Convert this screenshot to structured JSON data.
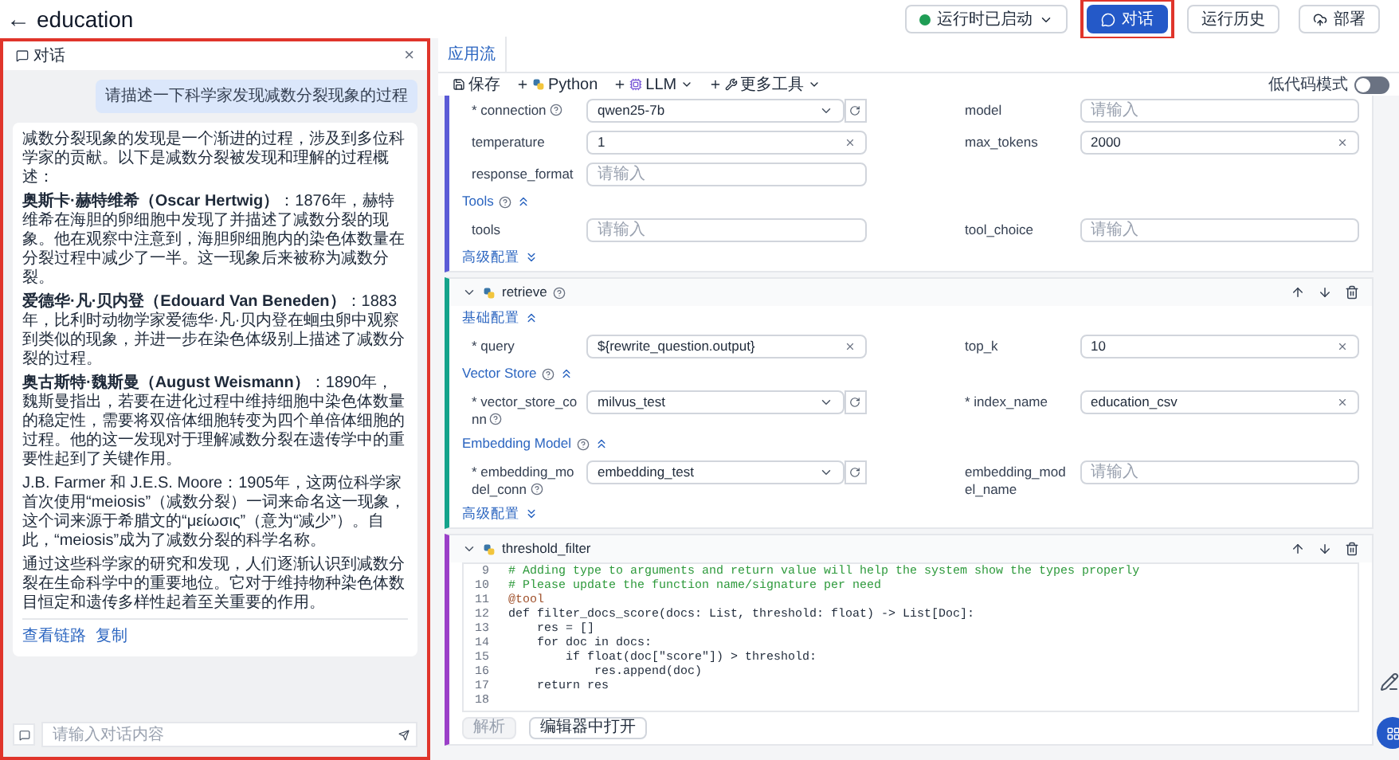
{
  "page": {
    "title": "education",
    "back": "←"
  },
  "header_actions": [
    {
      "kind": "status",
      "label": "运行时已启动",
      "highlighted": false
    },
    {
      "kind": "primary",
      "label": "对话",
      "highlighted": true
    },
    {
      "kind": "plain",
      "label": "运行历史",
      "highlighted": false
    },
    {
      "kind": "deploy",
      "label": "部署",
      "highlighted": false
    }
  ],
  "chat": {
    "title": "对话",
    "close": "×",
    "highlighted": true,
    "messages": [
      {
        "kind": "user",
        "paragraphs": [
          "请描述一下科学家发现减数分裂现象的过程"
        ]
      },
      {
        "kind": "assistant",
        "paragraphs": [
          "减数分裂现象的发现是一个渐进的过程，涉及到多位科学家的贡献。以下是减数分裂被发现和理解的过程概述：",
          "**奥斯卡·赫特维希（Oscar Hertwig）**：1876年，赫特维希在海胆的卵细胞中发现了并描述了减数分裂的现象。他在观察中注意到，海胆卵细胞内的染色体数量在分裂过程中减少了一半。这一现象后来被称为减数分裂。",
          "**爱德华·凡·贝内登（Edouard Van Beneden）**：1883年，比利时动物学家爱德华·凡·贝内登在蛔虫卵中观察到类似的现象，并进一步在染色体级别上描述了减数分裂的过程。",
          "**奥古斯特·魏斯曼（August Weismann）**：1890年，魏斯曼指出，若要在进化过程中维持细胞中染色体数量的稳定性，需要将双倍体细胞转变为四个单倍体细胞的过程。他的这一发现对于理解减数分裂在遗传学中的重要性起到了关键作用。",
          "J.B. Farmer 和 J.E.S. Moore：1905年，这两位科学家首次使用“meiosis”（减数分裂）一词来命名这一现象，这个词来源于希腊文的“μείωσις”（意为“减少”）。自此，“meiosis”成为了减数分裂的科学名称。",
          "通过这些科学家的研究和发现，人们逐渐认识到减数分裂在生命科学中的重要地位。它对于维持物种染色体数目恒定和遗传多样性起着至关重要的作用。"
        ],
        "links": [
          "查看链路",
          "复制"
        ]
      }
    ],
    "input": {
      "placeholder": "请输入对话内容"
    }
  },
  "workspace": {
    "tabs": [
      {
        "label": "应用流",
        "selected": true
      }
    ],
    "toolbar": [
      {
        "kind": "save",
        "label": "保存"
      },
      {
        "kind": "python",
        "label": "Python"
      },
      {
        "kind": "llm",
        "label": "LLM"
      },
      {
        "kind": "tools",
        "label": "更多工具"
      }
    ],
    "low_code": {
      "label": "低代码模式",
      "on": false
    },
    "nodes": [
      {
        "kind": "form",
        "color": "#5b5bd6",
        "sections": [
          {
            "rows": [
              [
                {
                  "label": "* connection",
                  "help": true,
                  "kind": "select",
                  "value": "qwen25-7b"
                },
                {
                  "label": "model",
                  "help": false,
                  "kind": "input",
                  "placeholder": "请输入"
                }
              ],
              [
                {
                  "label": "temperature",
                  "help": false,
                  "kind": "input",
                  "value": "1",
                  "clearable": true
                },
                {
                  "label": "max_tokens",
                  "help": false,
                  "kind": "input",
                  "value": "2000",
                  "clearable": true
                }
              ],
              [
                {
                  "label": "response_format",
                  "help": false,
                  "kind": "input",
                  "placeholder": "请输入",
                  "clearable": false
                }
              ]
            ]
          },
          {
            "title": "Tools",
            "help": true,
            "expanded": true,
            "rows": [
              [
                {
                  "label": "tools",
                  "help": false,
                  "kind": "input",
                  "placeholder": "请输入",
                  "clearable": false
                },
                {
                  "label": "tool_choice",
                  "help": false,
                  "kind": "input",
                  "placeholder": "请输入",
                  "clearable": false
                }
              ]
            ]
          },
          {
            "title": "高级配置",
            "help": false,
            "expanded": false
          }
        ]
      },
      {
        "kind": "form",
        "title": "retrieve",
        "help": true,
        "color": "#14a38b",
        "sections": [
          {
            "title": "基础配置",
            "help": false,
            "expanded": true,
            "rows": [
              [
                {
                  "label": "* query",
                  "help": false,
                  "kind": "input",
                  "value": "${rewrite_question.output}",
                  "clearable": true
                },
                {
                  "label": "top_k",
                  "help": false,
                  "kind": "input",
                  "value": "10",
                  "clearable": true
                }
              ]
            ]
          },
          {
            "title": "Vector Store",
            "help": true,
            "expanded": true,
            "rows": [
              [
                {
                  "label": "* vector_store_conn",
                  "help": true,
                  "kind": "select",
                  "value": "milvus_test"
                },
                {
                  "label": "* index_name",
                  "help": false,
                  "kind": "input",
                  "value": "education_csv",
                  "clearable": true
                }
              ]
            ]
          },
          {
            "title": "Embedding Model",
            "help": true,
            "expanded": true,
            "rows": [
              [
                {
                  "label": "* embedding_model_conn",
                  "help": true,
                  "kind": "select",
                  "value": "embedding_test"
                },
                {
                  "label": "embedding_model_name",
                  "help": false,
                  "kind": "input",
                  "placeholder": "请输入",
                  "clearable": false
                }
              ]
            ]
          },
          {
            "title": "高级配置",
            "help": false,
            "expanded": false
          }
        ]
      },
      {
        "kind": "code",
        "title": "threshold_filter",
        "help": false,
        "color": "#9b3fc8",
        "lines": [
          {
            "no": "9",
            "text": "# Adding type to arguments and return value will help the system show the types properly",
            "kind": "comment"
          },
          {
            "no": "10",
            "text": "# Please update the function name/signature per need",
            "kind": "comment"
          },
          {
            "no": "11",
            "text": "@tool",
            "kind": "decorator"
          },
          {
            "no": "12",
            "text": "def filter_docs_score(docs: List, threshold: float) -> List[Doc]:",
            "kind": "code"
          },
          {
            "no": "13",
            "text": "    res = []",
            "kind": "code"
          },
          {
            "no": "14",
            "text": "    for doc in docs:",
            "kind": "code"
          },
          {
            "no": "15",
            "text": "        if float(doc[\"score\"]) > threshold:",
            "kind": "code"
          },
          {
            "no": "16",
            "text": "            res.append(doc)",
            "kind": "code"
          },
          {
            "no": "17",
            "text": "    return res",
            "kind": "code"
          },
          {
            "no": "18",
            "kind": "code"
          }
        ],
        "buttons": [
          {
            "label": "解析",
            "disabled": true
          },
          {
            "label": "编辑器中打开",
            "disabled": false
          }
        ]
      }
    ]
  }
}
